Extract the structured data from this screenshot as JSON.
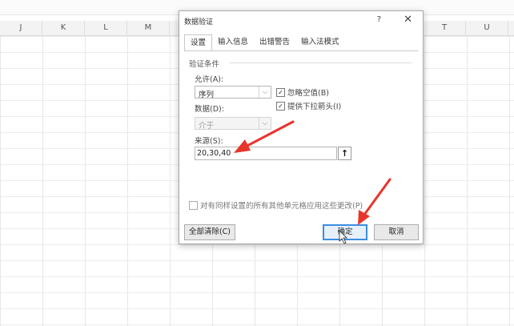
{
  "sheet": {
    "columns_left": [
      "J",
      "K",
      "L",
      "M"
    ],
    "columns_right": [
      "T",
      "U"
    ]
  },
  "dialog": {
    "title": "数据验证",
    "help_glyph": "?",
    "close_glyph": "✕",
    "tabs": [
      "设置",
      "输入信息",
      "出错警告",
      "输入法模式"
    ],
    "active_tab": 0,
    "section_label": "验证条件",
    "allow_label": "允许(A):",
    "allow_value": "序列",
    "data_label": "数据(D):",
    "data_value": "介于",
    "ignore_blank_label": "忽略空值(B)",
    "ignore_blank_checked": true,
    "dropdown_label": "提供下拉箭头(I)",
    "dropdown_checked": true,
    "source_label": "来源(S):",
    "source_value": "20,30,40",
    "ref_button_glyph": "🡡",
    "apply_all_label": "对有同样设置的所有其他单元格应用这些更改(P)",
    "apply_all_checked": false,
    "clear_all_label": "全部清除(C)",
    "ok_label": "确定",
    "cancel_label": "取消"
  },
  "annotation_color": "#e8352c"
}
